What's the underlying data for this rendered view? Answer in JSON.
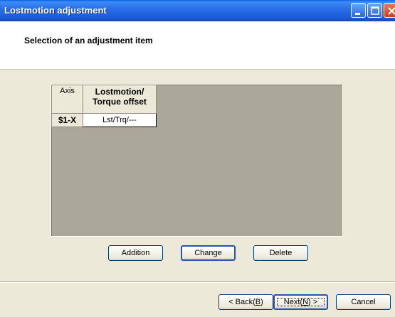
{
  "window": {
    "title": "Lostmotion adjustment"
  },
  "header": {
    "title": "Selection of an adjustment item"
  },
  "grid": {
    "columns": [
      "Axis",
      "Lostmotion/",
      "Torque offset"
    ],
    "rows": [
      {
        "axis": "$1-X",
        "value": "Lst/Trq/---"
      }
    ]
  },
  "actions": {
    "addition": "Addition",
    "change": "Change",
    "delete": "Delete"
  },
  "nav": {
    "back_prefix": "< Back(",
    "back_key": "B",
    "back_suffix": ")",
    "next_prefix": "Next(",
    "next_key": "N",
    "next_suffix": ") >",
    "cancel": "Cancel"
  },
  "icons": {
    "minimize": "minimize-icon",
    "maximize": "maximize-icon",
    "close": "close-icon"
  },
  "colors": {
    "titlebar": "#2a6fe9",
    "face": "#ece9d8",
    "grid_bg": "#aca899"
  }
}
